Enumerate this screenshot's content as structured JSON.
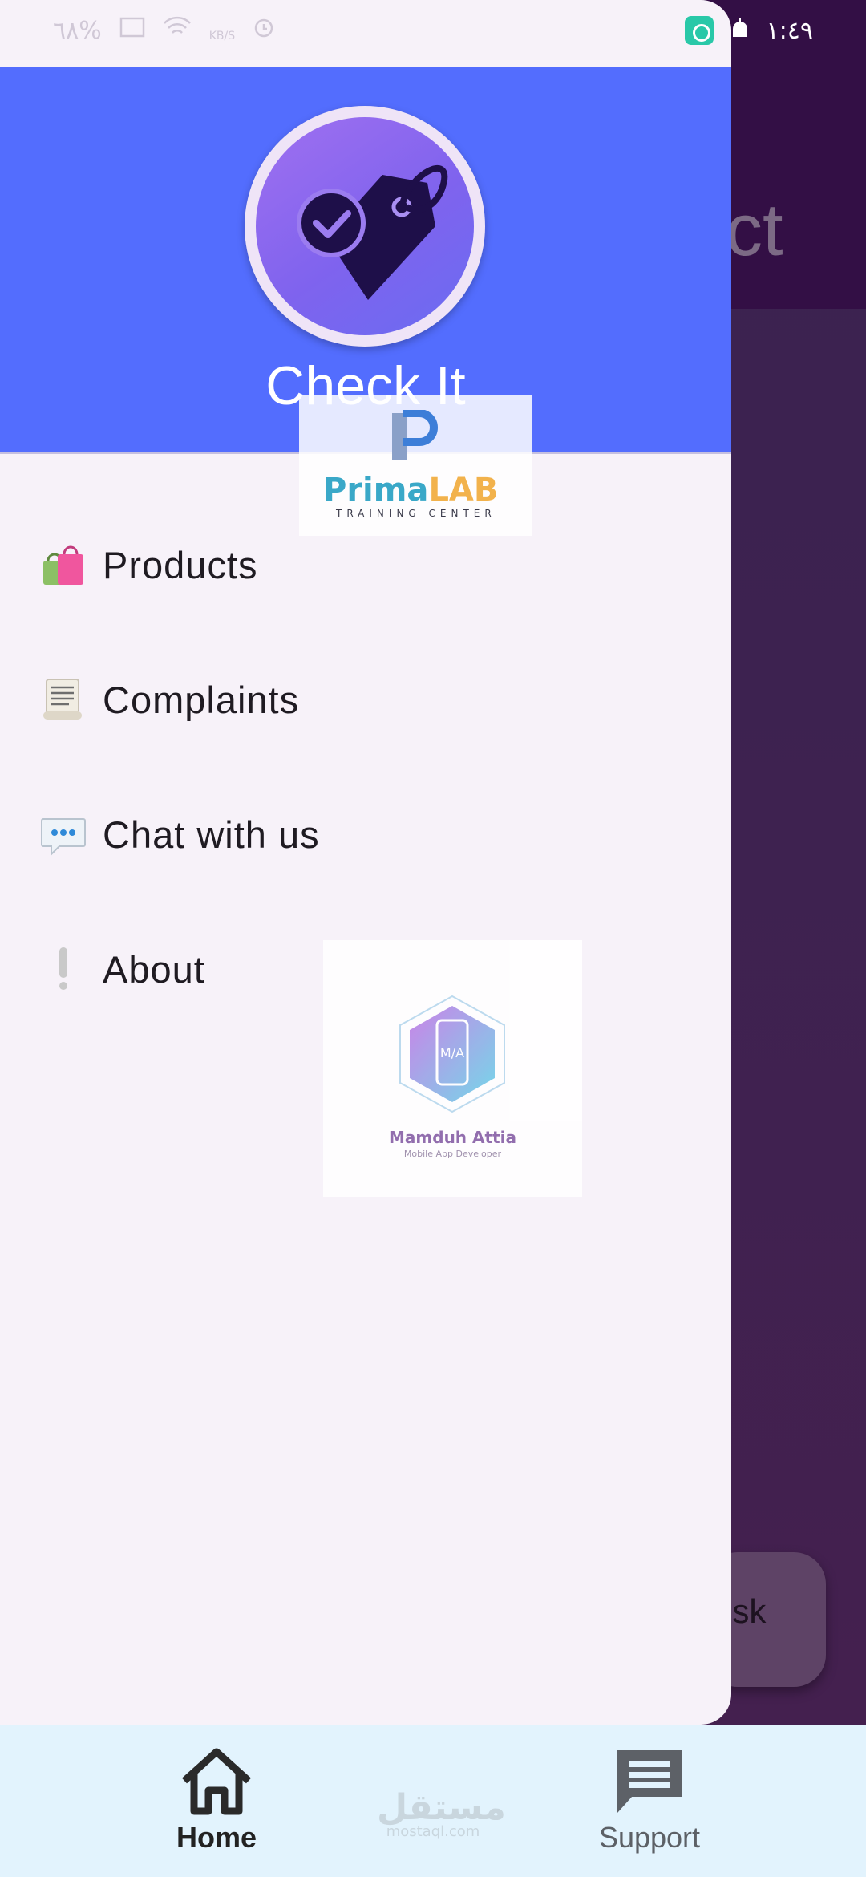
{
  "status_bar": {
    "left_indicators": "٦٨%",
    "time": "١:٤٩",
    "speed_unit": "KB/S"
  },
  "background_screen": {
    "title_fragment": "ct",
    "fab_fragment": "esk"
  },
  "drawer": {
    "app_title": "Check It",
    "colors": {
      "header": "#536dfe",
      "drawer_bg": "#f7f2f9"
    },
    "items": [
      {
        "label": "Products",
        "icon": "shopping-bags-icon"
      },
      {
        "label": "Complaints",
        "icon": "scroll-icon"
      },
      {
        "label": "Chat with us",
        "icon": "speech-bubble-icon"
      },
      {
        "label": "About",
        "icon": "exclamation-icon"
      }
    ]
  },
  "watermarks": {
    "prima": {
      "word_1": "Prima",
      "word_2": "LAB",
      "subtitle": "TRAINING CENTER"
    },
    "mamduh": {
      "badge": "M/A",
      "name": "Mamduh Attia",
      "role": "Mobile App Developer"
    },
    "mostaql": {
      "arabic": "مستقل",
      "latin": "mostaql.com"
    }
  },
  "bottom_nav": {
    "items": [
      {
        "label": "Home",
        "icon": "home-icon",
        "selected": true
      },
      {
        "label": "Support",
        "icon": "chat-icon",
        "selected": false
      }
    ]
  }
}
